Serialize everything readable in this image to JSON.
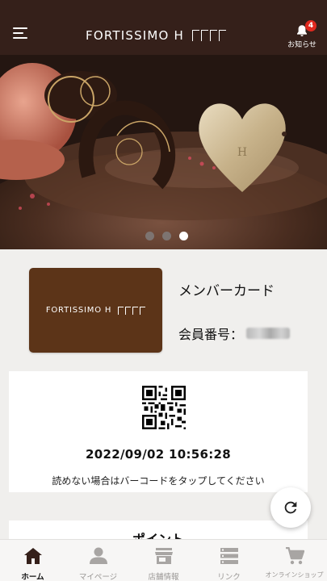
{
  "header": {
    "brand": "FORTISSIMO H",
    "notifications": {
      "label": "お知らせ",
      "count": "4",
      "icon": "bell-icon"
    },
    "menu_icon": "hamburger-icon"
  },
  "carousel": {
    "slides": 3,
    "active_index": 2
  },
  "member": {
    "card_logo": "FORTISSIMO H",
    "title": "メンバーカード",
    "number_label": "会員番号："
  },
  "qr": {
    "datetime": "2022/09/02 10:56:28",
    "hint": "読めない場合はバーコードをタップしてください"
  },
  "point": {
    "title": "ポイント"
  },
  "nav": {
    "items": [
      {
        "label": "ホーム",
        "icon": "home-icon",
        "active": true
      },
      {
        "label": "マイページ",
        "icon": "user-icon",
        "active": false
      },
      {
        "label": "店舗情報",
        "icon": "store-icon",
        "active": false
      },
      {
        "label": "リンク",
        "icon": "list-icon",
        "active": false
      },
      {
        "label": "オンラインショップ",
        "icon": "cart-icon",
        "active": false
      }
    ]
  },
  "colors": {
    "header": "#35201a",
    "card": "#5c3418",
    "badge": "#e0291f"
  }
}
